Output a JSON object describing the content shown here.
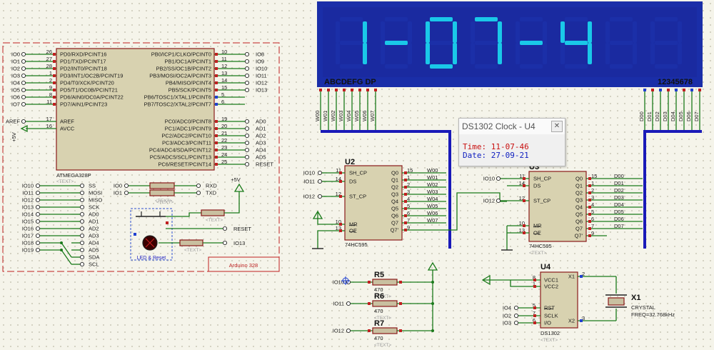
{
  "display": {
    "chars": [
      "1",
      "-",
      "0",
      "7",
      "-",
      "4"
    ],
    "left_label": "ABCDEFG DP",
    "right_label": "12345678"
  },
  "mcu": {
    "left_pins": [
      {
        "num": "26",
        "name": "PD0/RXD/PCINT16",
        "net": "IO0"
      },
      {
        "num": "27",
        "name": "PD1/TXD/PCINT17",
        "net": "IO1"
      },
      {
        "num": "28",
        "name": "PD2/INT0/PCINT18",
        "net": "IO2"
      },
      {
        "num": "1",
        "name": "PD3/INT1/OC2B/PCINT19",
        "net": "IO3"
      },
      {
        "num": "2",
        "name": "PD4/T0/XCK/PCINT20",
        "net": "IO4"
      },
      {
        "num": "9",
        "name": "PD5/T1/OC0B/PCINT21",
        "net": "IO5"
      },
      {
        "num": "8",
        "name": "PD6/AIN0/OC0A/PCINT22",
        "net": "IO6"
      },
      {
        "num": "11",
        "name": "PD7/AIN1/PCINT23",
        "net": "IO7"
      }
    ],
    "right_pins": [
      {
        "num": "10",
        "name": "PB0/ICP1/CLKO/PCINT0",
        "net": "IO8"
      },
      {
        "num": "11",
        "name": "PB1/OC1A/PCINT1",
        "net": "IO9"
      },
      {
        "num": "12",
        "name": "PB2/SS/OC1B/PCINT2",
        "net": "IO10"
      },
      {
        "num": "13",
        "name": "PB3/MOSI/OC2A/PCINT3",
        "net": "IO11"
      },
      {
        "num": "14",
        "name": "PB4/MISO/PCINT4",
        "net": "IO12"
      },
      {
        "num": "15",
        "name": "PB5/SCK/PCINT5",
        "net": "IO13"
      },
      {
        "num": "5",
        "name": "PB6/TOSC1/XTAL1/PCINT6",
        "net": ""
      },
      {
        "num": "6",
        "name": "PB7/TOSC2/XTAL2/PCINT7",
        "net": ""
      }
    ],
    "analog_pins": [
      {
        "num": "19",
        "name": "PC0/ADC0/PCINT8",
        "net": "AD0"
      },
      {
        "num": "20",
        "name": "PC1/ADC1/PCINT9",
        "net": "AD1"
      },
      {
        "num": "21",
        "name": "PC2/ADC2/PCINT10",
        "net": "AD2"
      },
      {
        "num": "22",
        "name": "PC3/ADC3/PCINT11",
        "net": "AD3"
      },
      {
        "num": "23",
        "name": "PC4/ADC4/SDA/PCINT12",
        "net": "AD4"
      },
      {
        "num": "24",
        "name": "PC5/ADC5/SCL/PCINT13",
        "net": "AD5"
      },
      {
        "num": "25",
        "name": "PC6/RESET/PCINT14",
        "net": "RESET"
      }
    ],
    "aref": "AREF",
    "avcc": "AVCC",
    "aref_num": "17",
    "avcc_num": "16",
    "aref_net": "AREF",
    "plus5": "+5V",
    "part": "ATMEGA328P",
    "text": "<TEXT>"
  },
  "header_left": [
    "IO10",
    "IO11",
    "IO12",
    "IO13",
    "IO14",
    "IO15",
    "IO16",
    "IO17",
    "IO18",
    "IO19"
  ],
  "header_right": [
    "SS",
    "MOSI",
    "MISO",
    "SCK",
    "AD0",
    "AD1",
    "AD2",
    "AD3",
    "AD4",
    "AD5",
    "SDA",
    "SCL"
  ],
  "serial": {
    "in": [
      "IO0",
      "IO1"
    ],
    "out": [
      "RXD",
      "TXD"
    ],
    "text": "<TEXT>"
  },
  "reset": {
    "net": "RESET",
    "io13": "IO13",
    "plus5": "+5V",
    "label": "LED & Reset",
    "text": "<TEXT>"
  },
  "arduino_label": "Arduino 328",
  "u2": {
    "ref": "U2",
    "part": "74HC595",
    "pins_left": [
      {
        "num": "11",
        "name": "SH_CP",
        "net": "IO10"
      },
      {
        "num": "14",
        "name": "DS",
        "net": "IO11"
      },
      {
        "num": "12",
        "name": "ST_CP",
        "net": "IO12"
      },
      {
        "num": "10",
        "name": "MR",
        "net": ""
      },
      {
        "num": "13",
        "name": "OE",
        "net": ""
      }
    ],
    "pins_right": [
      {
        "num": "15",
        "name": "Q0",
        "net": "W00"
      },
      {
        "num": "1",
        "name": "Q1",
        "net": "W01"
      },
      {
        "num": "2",
        "name": "Q2",
        "net": "W02"
      },
      {
        "num": "3",
        "name": "Q3",
        "net": "W03"
      },
      {
        "num": "4",
        "name": "Q4",
        "net": "W04"
      },
      {
        "num": "5",
        "name": "Q5",
        "net": "W05"
      },
      {
        "num": "6",
        "name": "Q6",
        "net": "W06"
      },
      {
        "num": "7",
        "name": "Q7",
        "net": "W07"
      },
      {
        "num": "9",
        "name": "Q7'",
        "net": ""
      }
    ]
  },
  "u3": {
    "ref": "U3",
    "part": "74HC595",
    "text": "<TEXT>",
    "pins_left": [
      {
        "num": "11",
        "name": "SH_CP",
        "net": "IO10"
      },
      {
        "num": "14",
        "name": "DS",
        "net": ""
      },
      {
        "num": "12",
        "name": "ST_CP",
        "net": "IO12"
      },
      {
        "num": "10",
        "name": "MR",
        "net": ""
      },
      {
        "num": "13",
        "name": "OE",
        "net": ""
      }
    ],
    "pins_right": [
      {
        "num": "15",
        "name": "Q0",
        "net": "D00"
      },
      {
        "num": "1",
        "name": "Q1",
        "net": "D01"
      },
      {
        "num": "2",
        "name": "Q2",
        "net": "D02"
      },
      {
        "num": "3",
        "name": "Q3",
        "net": "D03"
      },
      {
        "num": "4",
        "name": "Q4",
        "net": "D04"
      },
      {
        "num": "5",
        "name": "Q5",
        "net": "D05"
      },
      {
        "num": "6",
        "name": "Q6",
        "net": "D06"
      },
      {
        "num": "7",
        "name": "Q7",
        "net": "D07"
      },
      {
        "num": "9",
        "name": "Q7'",
        "net": ""
      }
    ]
  },
  "w_bus": [
    "W00",
    "W01",
    "W02",
    "W03",
    "W04",
    "W05",
    "W06",
    "W07"
  ],
  "d_bus": [
    "D00",
    "D01",
    "D02",
    "D03",
    "D04",
    "D05",
    "D06",
    "D07"
  ],
  "resistors": [
    {
      "ref": "R5",
      "value": "470",
      "net": "IO10",
      "text": "<TEXT>"
    },
    {
      "ref": "R6",
      "value": "470",
      "net": "IO11",
      "text": "<TEXT>"
    },
    {
      "ref": "R7",
      "value": "470",
      "net": "IO12",
      "text": "<TEXT>"
    }
  ],
  "u4": {
    "ref": "U4",
    "part": "DS1302",
    "text": "<TEXT>",
    "pins_left": [
      {
        "num": "8",
        "name": "VCC1",
        "net": ""
      },
      {
        "num": "1",
        "name": "VCC2",
        "net": ""
      },
      {
        "num": "5",
        "name": "RST",
        "net": "IO4"
      },
      {
        "num": "7",
        "name": "SCLK",
        "net": "IO2"
      },
      {
        "num": "6",
        "name": "I/O",
        "net": "IO3"
      }
    ],
    "pins_right": [
      {
        "num": "2",
        "name": "X1"
      },
      {
        "num": "3",
        "name": "X2"
      }
    ]
  },
  "crystal": {
    "ref": "X1",
    "type": "CRYSTAL",
    "freq": "FREQ=32.768kHz"
  },
  "popup": {
    "title": "DS1302 Clock - U4",
    "time_label": "Time:",
    "time_value": "11-07-46",
    "date_label": "Date:",
    "date_value": "27-09-21",
    "time_color": "#c81010",
    "date_color": "#1020c0"
  },
  "colors": {
    "wire": "#1a7a1a",
    "component": "#8a1a1a",
    "body": "#d8d2b0",
    "bus": "#1a1ab8",
    "display_bg": "#1a2ea8",
    "segment_on": "#1ac8e8"
  }
}
